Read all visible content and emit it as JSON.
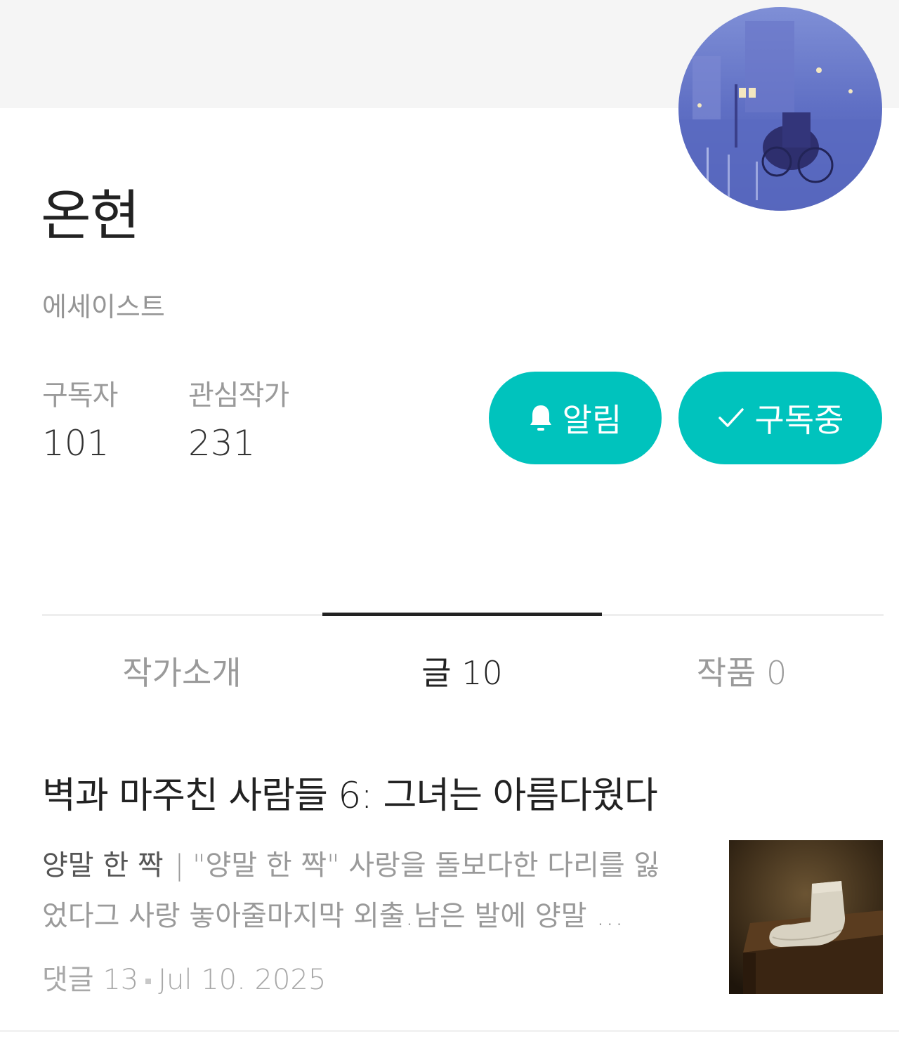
{
  "profile": {
    "name": "온현",
    "role": "에세이스트",
    "avatar_icon": "rainy-street-painting"
  },
  "stats": {
    "subscribers_label": "구독자",
    "subscribers_value": "101",
    "following_label": "관심작가",
    "following_value": "231"
  },
  "actions": {
    "notify_label": "알림",
    "notify_icon": "bell-icon",
    "subscribed_label": "구독중",
    "subscribed_icon": "check-icon",
    "accent_color": "#00c3bd"
  },
  "tabs": [
    {
      "label": "작가소개",
      "active": false
    },
    {
      "label": "글 10",
      "active": true
    },
    {
      "label": "작품 0",
      "active": false
    }
  ],
  "posts": [
    {
      "title": "벽과 마주친 사람들 6: 그녀는 아름다웠다",
      "subtitle": "양말 한 짝",
      "separator": "|",
      "excerpt": "\"양말 한 짝\"  사랑을 돌보다한 다리를 잃었다그 사랑 놓아줄마지막 외출.남은 발에 양말 …",
      "comments": "댓글 13",
      "date": "Jul 10. 2025",
      "thumbnail_icon": "sock-photo"
    }
  ]
}
